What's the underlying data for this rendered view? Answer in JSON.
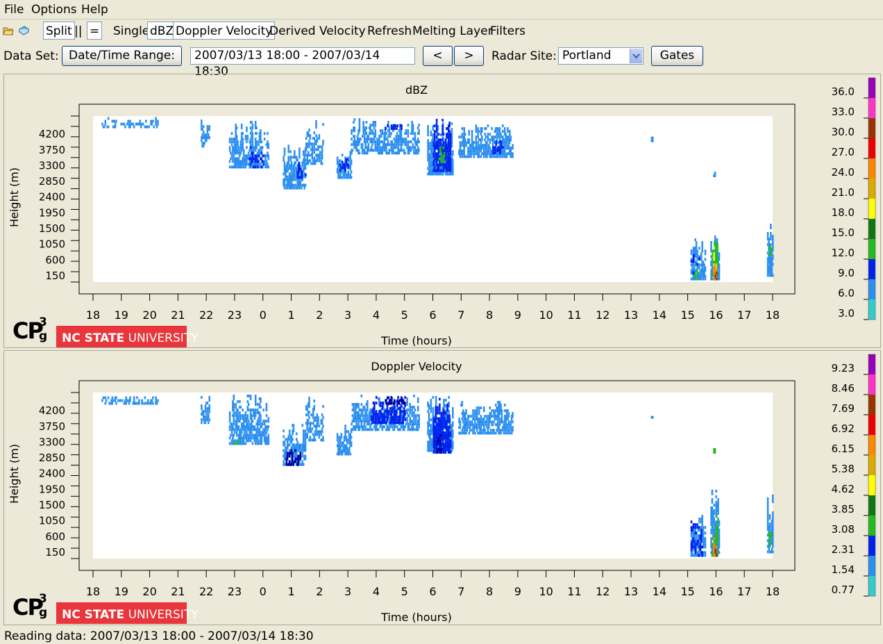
{
  "menu": {
    "items": [
      "File",
      "Options",
      "Help"
    ]
  },
  "toolbar": {
    "split": "Split",
    "bars": "||",
    "equals": "=",
    "single": "Single",
    "dbz": "dBZ",
    "doppler": "Doppler Velocity",
    "derived": "Derived Velocity",
    "refresh": "Refresh",
    "melting": "Melting Layer",
    "filters": "Filters"
  },
  "controls": {
    "dataset_label": "Data Set:",
    "date_range_button": "Date/Time Range:",
    "date_range_value": "2007/03/13 18:00 - 2007/03/14 18:30",
    "prev": "<",
    "next": ">",
    "radar_label": "Radar Site:",
    "radar_value": "Portland",
    "gates": "Gates"
  },
  "logo": {
    "cpg": "CP",
    "cpg_sup": "3",
    "cpg_sub": "g",
    "ncsu_bold": "NC STATE",
    "ncsu_rest": " UNIVERSITY"
  },
  "colors": {
    "cyan": "#33cccc",
    "lightblue": "#2b8ff0",
    "blue": "#0022ee",
    "darkblue": "#000099",
    "green": "#22bb22",
    "darkgreen": "#117711",
    "yellow": "#ffff00",
    "gold": "#ddaa00",
    "orange": "#ff8800",
    "red": "#ee0000",
    "brown": "#993300",
    "magenta": "#ff33cc",
    "purple": "#9900bb",
    "ncsu_red": "#e8363c"
  },
  "chart_data": [
    {
      "type": "heatmap",
      "title": "dBZ",
      "xlabel": "Time (hours)",
      "ylabel": "Height (m)",
      "x_ticks": [
        "18",
        "19",
        "20",
        "21",
        "22",
        "23",
        "0",
        "1",
        "2",
        "3",
        "4",
        "5",
        "6",
        "7",
        "8",
        "9",
        "10",
        "11",
        "12",
        "13",
        "14",
        "15",
        "16",
        "17",
        "18"
      ],
      "y_ticks": [
        150,
        600,
        1050,
        1500,
        1950,
        2400,
        2850,
        3300,
        3750,
        4200
      ],
      "colorbar_labels": [
        "36.0",
        "33.0",
        "30.0",
        "27.0",
        "24.0",
        "21.0",
        "18.0",
        "15.0",
        "12.0",
        "9.0",
        "6.0",
        "3.0"
      ],
      "colorbar_colors": [
        "#9900bb",
        "#ff33cc",
        "#993300",
        "#ee0000",
        "#ff8800",
        "#ddaa00",
        "#ffff00",
        "#117711",
        "#22bb22",
        "#0022ee",
        "#2b8ff0",
        "#33cccc"
      ],
      "clusters": [
        {
          "t0": 18.3,
          "t1": 20.3,
          "h0": 4350,
          "h1": 4600,
          "color": "#2b8ff0",
          "density": 0.35
        },
        {
          "t0": 21.8,
          "t1": 22.1,
          "h0": 3800,
          "h1": 4600,
          "color": "#2b8ff0",
          "density": 0.5
        },
        {
          "t0": 22.8,
          "t1": 24.2,
          "h0": 3200,
          "h1": 4600,
          "color": "#2b8ff0",
          "density": 0.55
        },
        {
          "t0": 23.5,
          "t1": 24.0,
          "h0": 3200,
          "h1": 4000,
          "color": "#0022ee",
          "density": 0.25
        },
        {
          "t0": 24.7,
          "t1": 25.5,
          "h0": 2600,
          "h1": 3900,
          "color": "#2b8ff0",
          "density": 0.6
        },
        {
          "t0": 25.2,
          "t1": 25.5,
          "h0": 2900,
          "h1": 3500,
          "color": "#0022ee",
          "density": 0.3
        },
        {
          "t0": 25.5,
          "t1": 26.1,
          "h0": 3300,
          "h1": 4600,
          "color": "#2b8ff0",
          "density": 0.45
        },
        {
          "t0": 26.6,
          "t1": 27.1,
          "h0": 2900,
          "h1": 3800,
          "color": "#2b8ff0",
          "density": 0.65
        },
        {
          "t0": 26.7,
          "t1": 27.0,
          "h0": 3100,
          "h1": 3600,
          "color": "#0022ee",
          "density": 0.45
        },
        {
          "t0": 27.1,
          "t1": 29.5,
          "h0": 3600,
          "h1": 4600,
          "color": "#2b8ff0",
          "density": 0.55
        },
        {
          "t0": 28.2,
          "t1": 28.9,
          "h0": 4300,
          "h1": 4450,
          "color": "#0022ee",
          "density": 0.4
        },
        {
          "t0": 29.8,
          "t1": 30.7,
          "h0": 3000,
          "h1": 4600,
          "color": "#2b8ff0",
          "density": 0.75
        },
        {
          "t0": 30.0,
          "t1": 30.6,
          "h0": 3100,
          "h1": 4600,
          "color": "#0022ee",
          "density": 0.7
        },
        {
          "t0": 30.2,
          "t1": 30.4,
          "h0": 3350,
          "h1": 3800,
          "color": "#22bb22",
          "density": 0.6
        },
        {
          "t0": 30.9,
          "t1": 32.8,
          "h0": 3500,
          "h1": 4450,
          "color": "#2b8ff0",
          "density": 0.6
        },
        {
          "t0": 32.1,
          "t1": 32.5,
          "h0": 3600,
          "h1": 4000,
          "color": "#0022ee",
          "density": 0.4
        },
        {
          "t0": 37.7,
          "t1": 37.75,
          "h0": 3950,
          "h1": 4050,
          "color": "#2b8ff0",
          "density": 1.0
        },
        {
          "t0": 39.9,
          "t1": 39.95,
          "h0": 2950,
          "h1": 3050,
          "color": "#2b8ff0",
          "density": 1.0
        },
        {
          "t0": 39.1,
          "t1": 39.6,
          "h0": 0,
          "h1": 1300,
          "color": "#2b8ff0",
          "density": 0.65
        },
        {
          "t0": 39.1,
          "t1": 39.4,
          "h0": 100,
          "h1": 900,
          "color": "#0022ee",
          "density": 0.25
        },
        {
          "t0": 39.2,
          "t1": 39.4,
          "h0": 0,
          "h1": 600,
          "color": "#22bb22",
          "density": 0.35
        },
        {
          "t0": 39.8,
          "t1": 40.1,
          "h0": 0,
          "h1": 1950,
          "color": "#2b8ff0",
          "density": 0.75
        },
        {
          "t0": 39.85,
          "t1": 40.05,
          "h0": 100,
          "h1": 1600,
          "color": "#22bb22",
          "density": 0.55
        },
        {
          "t0": 39.9,
          "t1": 40.0,
          "h0": 0,
          "h1": 1000,
          "color": "#ffff00",
          "density": 0.6
        },
        {
          "t0": 39.9,
          "t1": 40.0,
          "h0": 0,
          "h1": 700,
          "color": "#ff8800",
          "density": 0.5
        },
        {
          "t0": 39.95,
          "t1": 40.0,
          "h0": 0,
          "h1": 500,
          "color": "#993300",
          "density": 0.4
        },
        {
          "t0": 41.8,
          "t1": 42.0,
          "h0": 100,
          "h1": 1800,
          "color": "#2b8ff0",
          "density": 0.75
        },
        {
          "t0": 41.85,
          "t1": 41.95,
          "h0": 700,
          "h1": 1200,
          "color": "#22bb22",
          "density": 0.4
        }
      ]
    },
    {
      "type": "heatmap",
      "title": "Doppler Velocity",
      "xlabel": "Time (hours)",
      "ylabel": "Height (m)",
      "x_ticks": [
        "18",
        "19",
        "20",
        "21",
        "22",
        "23",
        "0",
        "1",
        "2",
        "3",
        "4",
        "5",
        "6",
        "7",
        "8",
        "9",
        "10",
        "11",
        "12",
        "13",
        "14",
        "15",
        "16",
        "17",
        "18"
      ],
      "y_ticks": [
        150,
        600,
        1050,
        1500,
        1950,
        2400,
        2850,
        3300,
        3750,
        4200
      ],
      "colorbar_labels": [
        "9.23",
        "8.46",
        "7.69",
        "6.92",
        "6.15",
        "5.38",
        "4.62",
        "3.85",
        "3.08",
        "2.31",
        "1.54",
        "0.77"
      ],
      "colorbar_colors": [
        "#9900bb",
        "#ff33cc",
        "#993300",
        "#ee0000",
        "#ff8800",
        "#ddaa00",
        "#ffff00",
        "#117711",
        "#22bb22",
        "#0022ee",
        "#2b8ff0",
        "#33cccc"
      ],
      "clusters": [
        {
          "t0": 18.3,
          "t1": 20.3,
          "h0": 4350,
          "h1": 4600,
          "color": "#2b8ff0",
          "density": 0.35
        },
        {
          "t0": 21.8,
          "t1": 22.1,
          "h0": 3800,
          "h1": 4600,
          "color": "#2b8ff0",
          "density": 0.5
        },
        {
          "t0": 22.8,
          "t1": 24.2,
          "h0": 3200,
          "h1": 4600,
          "color": "#2b8ff0",
          "density": 0.55
        },
        {
          "t0": 22.9,
          "t1": 23.2,
          "h0": 3200,
          "h1": 3400,
          "color": "#22bb22",
          "density": 0.25
        },
        {
          "t0": 24.7,
          "t1": 25.5,
          "h0": 2600,
          "h1": 3900,
          "color": "#2b8ff0",
          "density": 0.6
        },
        {
          "t0": 24.8,
          "t1": 25.3,
          "h0": 2600,
          "h1": 3200,
          "color": "#000099",
          "density": 0.45
        },
        {
          "t0": 25.5,
          "t1": 26.1,
          "h0": 3300,
          "h1": 4600,
          "color": "#2b8ff0",
          "density": 0.45
        },
        {
          "t0": 26.6,
          "t1": 27.1,
          "h0": 2900,
          "h1": 3800,
          "color": "#2b8ff0",
          "density": 0.65
        },
        {
          "t0": 27.1,
          "t1": 29.5,
          "h0": 3600,
          "h1": 4600,
          "color": "#2b8ff0",
          "density": 0.55
        },
        {
          "t0": 27.8,
          "t1": 29.0,
          "h0": 3800,
          "h1": 4600,
          "color": "#0022ee",
          "density": 0.55
        },
        {
          "t0": 28.3,
          "t1": 29.0,
          "h0": 4350,
          "h1": 4600,
          "color": "#000099",
          "density": 0.55
        },
        {
          "t0": 29.8,
          "t1": 30.7,
          "h0": 3000,
          "h1": 4600,
          "color": "#2b8ff0",
          "density": 0.75
        },
        {
          "t0": 30.0,
          "t1": 30.6,
          "h0": 2950,
          "h1": 4600,
          "color": "#0022ee",
          "density": 0.75
        },
        {
          "t0": 30.1,
          "t1": 30.3,
          "h0": 2950,
          "h1": 3600,
          "color": "#000099",
          "density": 0.5
        },
        {
          "t0": 30.9,
          "t1": 32.8,
          "h0": 3500,
          "h1": 4450,
          "color": "#2b8ff0",
          "density": 0.6
        },
        {
          "t0": 37.7,
          "t1": 37.75,
          "h0": 3950,
          "h1": 4050,
          "color": "#2b8ff0",
          "density": 1.0
        },
        {
          "t0": 39.9,
          "t1": 39.95,
          "h0": 2950,
          "h1": 3050,
          "color": "#22bb22",
          "density": 1.0
        },
        {
          "t0": 39.1,
          "t1": 39.6,
          "h0": 0,
          "h1": 1300,
          "color": "#2b8ff0",
          "density": 0.65
        },
        {
          "t0": 39.1,
          "t1": 39.5,
          "h0": 0,
          "h1": 1000,
          "color": "#0022ee",
          "density": 0.4
        },
        {
          "t0": 39.8,
          "t1": 40.1,
          "h0": 0,
          "h1": 1950,
          "color": "#2b8ff0",
          "density": 0.75
        },
        {
          "t0": 39.85,
          "t1": 40.05,
          "h0": 0,
          "h1": 1200,
          "color": "#22bb22",
          "density": 0.55
        },
        {
          "t0": 39.9,
          "t1": 40.0,
          "h0": 0,
          "h1": 600,
          "color": "#ff8800",
          "density": 0.6
        },
        {
          "t0": 39.95,
          "t1": 40.0,
          "h0": 0,
          "h1": 300,
          "color": "#993300",
          "density": 0.4
        },
        {
          "t0": 41.8,
          "t1": 42.0,
          "h0": 100,
          "h1": 1800,
          "color": "#2b8ff0",
          "density": 0.75
        },
        {
          "t0": 41.85,
          "t1": 41.95,
          "h0": 300,
          "h1": 1200,
          "color": "#22bb22",
          "density": 0.45
        }
      ]
    }
  ],
  "status": {
    "text": "Reading data: 2007/03/13 18:00 - 2007/03/14 18:30"
  }
}
